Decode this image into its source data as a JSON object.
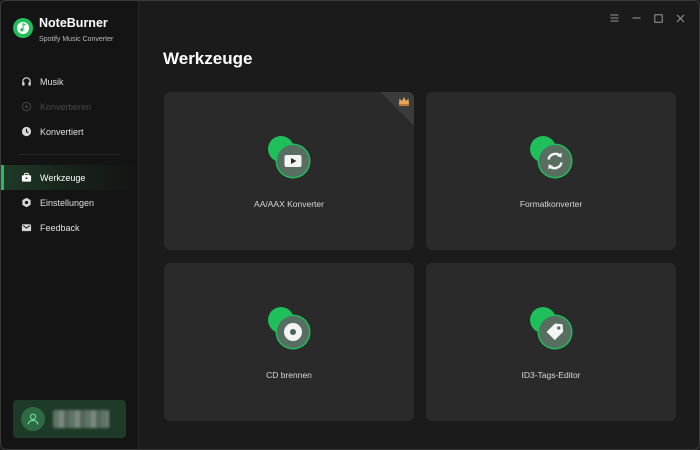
{
  "app": {
    "name": "NoteBurner",
    "subtitle": "Spotify Music Converter"
  },
  "sidebar": {
    "items": [
      {
        "label": "Musik",
        "icon": "headphones-icon",
        "state": "normal"
      },
      {
        "label": "Konvertieren",
        "icon": "convert-icon",
        "state": "disabled"
      },
      {
        "label": "Konvertiert",
        "icon": "clock-icon",
        "state": "normal"
      },
      {
        "label": "Werkzeuge",
        "icon": "toolbox-icon",
        "state": "active"
      },
      {
        "label": "Einstellungen",
        "icon": "gear-icon",
        "state": "normal"
      },
      {
        "label": "Feedback",
        "icon": "mail-icon",
        "state": "normal"
      }
    ]
  },
  "main": {
    "title": "Werkzeuge",
    "tools": [
      {
        "label": "AA/AAX Konverter",
        "icon": "play-video-icon",
        "premium": true
      },
      {
        "label": "Formatkonverter",
        "icon": "refresh-icon",
        "premium": false
      },
      {
        "label": "CD brennen",
        "icon": "disc-icon",
        "premium": false
      },
      {
        "label": "ID3-Tags-Editor",
        "icon": "tag-icon",
        "premium": false
      }
    ]
  },
  "colors": {
    "accent": "#1fbf5c",
    "sidebar_bg": "#141414",
    "main_bg": "#1b1b1b",
    "card_bg": "#2a2a2a"
  }
}
